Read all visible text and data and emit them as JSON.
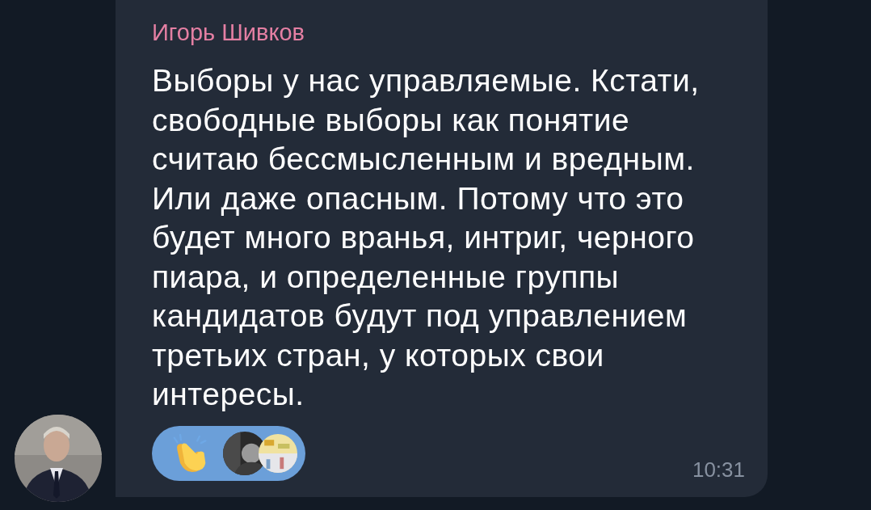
{
  "message": {
    "sender": "Игорь Шивков",
    "text": "Выборы у нас управляемые. Кстати,\nсвободные выборы как понятие\nсчитаю бессмысленным и вредным.\nИли даже опасным. Потому что это\nбудет много вранья, интриг, черного\nпиара, и определенные группы\nкандидатов будут под управлением\nтретьих стран, у которых свои\nинтересы.",
    "time": "10:31",
    "reactions": [
      {
        "kind": "clap"
      }
    ]
  }
}
